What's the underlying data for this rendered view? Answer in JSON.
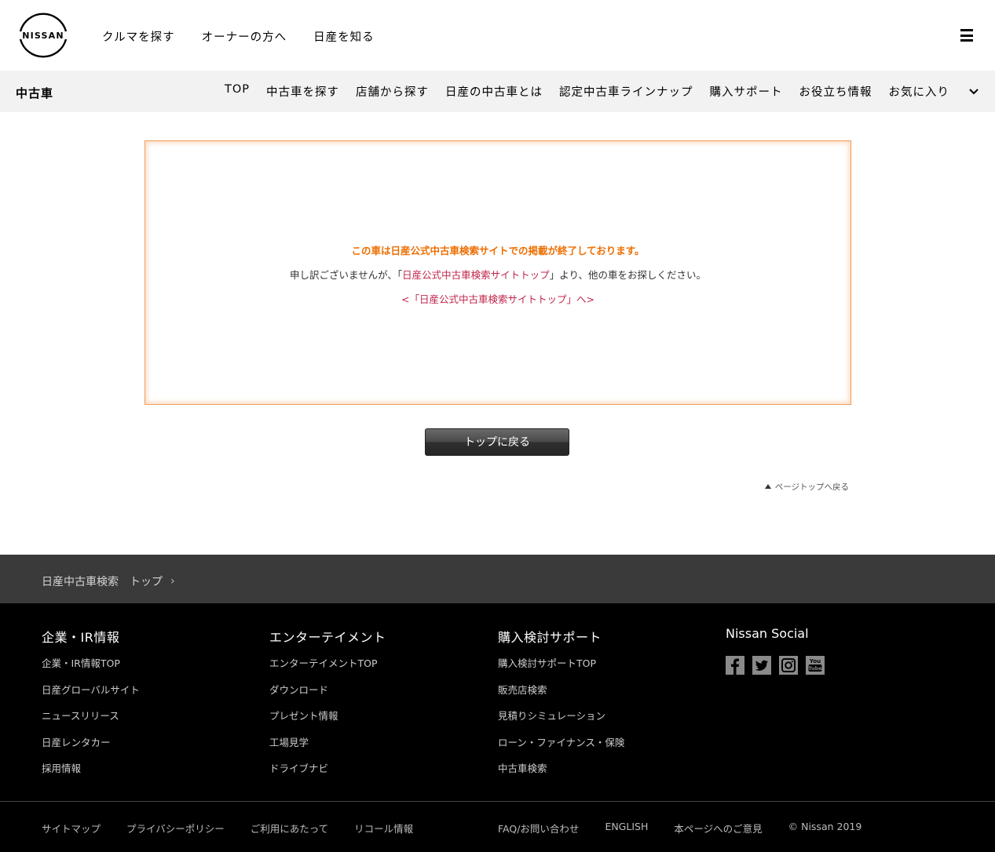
{
  "global_header": {
    "brand": "NISSAN",
    "nav": [
      "クルマを探す",
      "オーナーの方へ",
      "日産を知る"
    ]
  },
  "sub_header": {
    "section_title": "中古車",
    "nav": [
      "TOP",
      "中古車を探す",
      "店舗から探す",
      "日産の中古車とは",
      "認定中古車ラインナップ",
      "購入サポート",
      "お役立ち情報",
      "お気に入り"
    ]
  },
  "notice": {
    "title": "この車は日産公式中古車検索サイトでの掲載が終了しております。",
    "text_before": "申し訳ございませんが、「",
    "text_link": "日産公式中古車検索サイトトップ",
    "text_after": "」より、他の車をお探しください。",
    "link": "<「日産公式中古車検索サイトトップ」へ>"
  },
  "top_button": "トップに戻る",
  "page_top": "ページトップへ戻る",
  "breadcrumb": [
    "日産中古車検索",
    "トップ"
  ],
  "footer": {
    "columns": [
      {
        "title": "企業・IR情報",
        "items": [
          "企業・IR情報TOP",
          "日産グローバルサイト",
          "ニュースリリース",
          "日産レンタカー",
          "採用情報"
        ]
      },
      {
        "title": "エンターテイメント",
        "items": [
          "エンターテイメントTOP",
          "ダウンロード",
          "プレゼント情報",
          "工場見学",
          "ドライブナビ"
        ]
      },
      {
        "title": "購入検討サポート",
        "items": [
          "購入検討サポートTOP",
          "販売店検索",
          "見積りシミュレーション",
          "ローン・ファイナンス・保険",
          "中古車検索"
        ]
      }
    ],
    "social_title": "Nissan Social",
    "social_icons": [
      "facebook-icon",
      "twitter-icon",
      "instagram-icon",
      "youtube-icon"
    ],
    "youtube_text": [
      "You",
      "Tube"
    ],
    "bottom_left": [
      "サイトマップ",
      "プライバシーポリシー",
      "ご利用にあたって",
      "リコール情報"
    ],
    "bottom_right": [
      "FAQ/お問い合わせ",
      "ENGLISH",
      "本ページへのご意見",
      "© Nissan 2019"
    ]
  },
  "colors": {
    "accent_orange": "#ee6e00",
    "link_red": "#c0254b",
    "footer_bg": "#000000",
    "breadcrumb_bg": "#3a3a3a"
  }
}
